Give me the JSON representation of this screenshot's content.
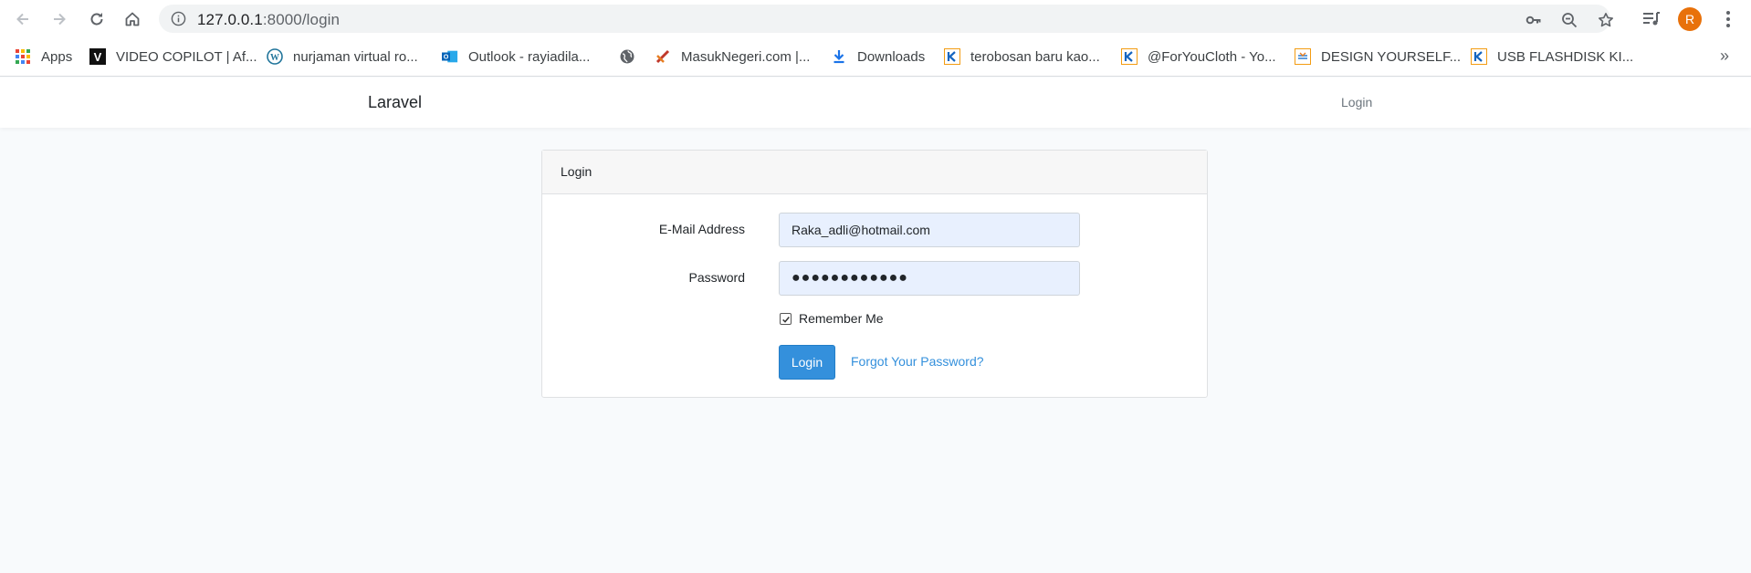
{
  "browser": {
    "url_host": "127.0.0.1",
    "url_path": ":8000/login",
    "profile_initial": "R",
    "bookmarks": [
      {
        "label": "Apps",
        "icon": "apps-grid-icon"
      },
      {
        "label": "VIDEO COPILOT | Af...",
        "icon": "video-copilot-icon"
      },
      {
        "label": "nurjaman virtual ro...",
        "icon": "wordpress-icon"
      },
      {
        "label": "Outlook - rayiadila...",
        "icon": "outlook-icon"
      },
      {
        "label": "",
        "icon": "globe-icon"
      },
      {
        "label": "MasukNegeri.com |...",
        "icon": "masuknegeri-icon"
      },
      {
        "label": "Downloads",
        "icon": "download-icon"
      },
      {
        "label": "terobosan baru kao...",
        "icon": "kaskus-icon"
      },
      {
        "label": "@ForYouCloth - Yo...",
        "icon": "kaskus-icon"
      },
      {
        "label": "DESIGN YOURSELF...",
        "icon": "kaskus-icon"
      },
      {
        "label": "USB FLASHDISK KI...",
        "icon": "kaskus-icon"
      }
    ],
    "more_label": "»"
  },
  "navbar": {
    "brand": "Laravel",
    "login_link": "Login"
  },
  "card": {
    "header": "Login",
    "email_label": "E-Mail Address",
    "email_value": "Raka_adli@hotmail.com",
    "password_label": "Password",
    "password_value": "●●●●●●●●●●●●",
    "remember_label": "Remember Me",
    "remember_checked": true,
    "login_button": "Login",
    "forgot_link": "Forgot Your Password?"
  },
  "colors": {
    "primary": "#3490dc",
    "autofill_bg": "#e8f0fe",
    "avatar": "#e8710a"
  }
}
